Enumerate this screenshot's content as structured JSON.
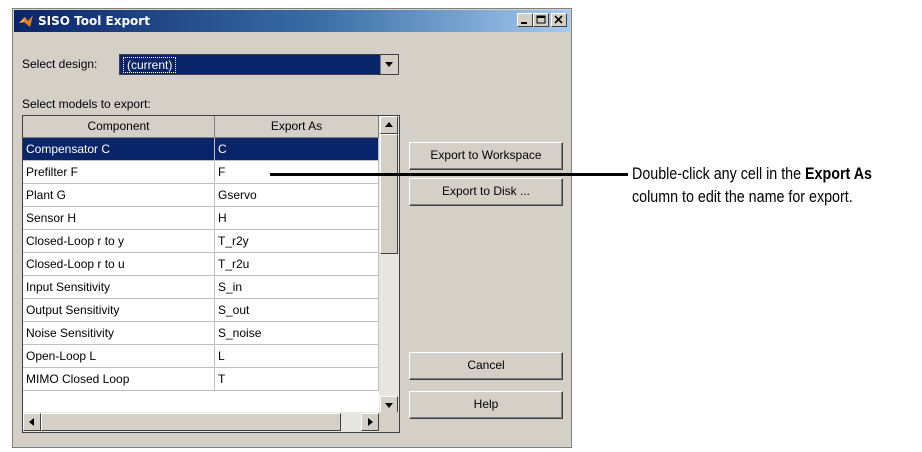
{
  "window": {
    "title": "SISO Tool Export",
    "title_icon": "matlab-icon",
    "controls": [
      "minimize-icon",
      "maximize-icon",
      "close-icon"
    ]
  },
  "design": {
    "label": "Select design:",
    "value": "(current)"
  },
  "models": {
    "label": "Select models to export:",
    "columns": [
      "Component",
      "Export As"
    ],
    "rows": [
      {
        "component": "Compensator C",
        "export_as": "C",
        "selected": true
      },
      {
        "component": "Prefilter F",
        "export_as": "F"
      },
      {
        "component": "Plant G",
        "export_as": "Gservo"
      },
      {
        "component": "Sensor H",
        "export_as": "H"
      },
      {
        "component": "Closed-Loop r to y",
        "export_as": "T_r2y"
      },
      {
        "component": "Closed-Loop r to u",
        "export_as": "T_r2u"
      },
      {
        "component": "Input Sensitivity",
        "export_as": "S_in"
      },
      {
        "component": "Output Sensitivity",
        "export_as": "S_out"
      },
      {
        "component": "Noise Sensitivity",
        "export_as": "S_noise"
      },
      {
        "component": "Open-Loop L",
        "export_as": "L"
      },
      {
        "component": "MIMO Closed Loop",
        "export_as": "T"
      }
    ]
  },
  "buttons": {
    "export_workspace": "Export to Workspace",
    "export_disk": "Export to Disk ...",
    "cancel": "Cancel",
    "help": "Help"
  },
  "annotation": {
    "part1": "Double-click any cell in the ",
    "bold": "Export As",
    "part2": "column to edit the name for export."
  },
  "colors": {
    "title_bar_start": "#0a246a",
    "selection": "#0a246a",
    "dialog_bg": "#d4d0c8"
  }
}
